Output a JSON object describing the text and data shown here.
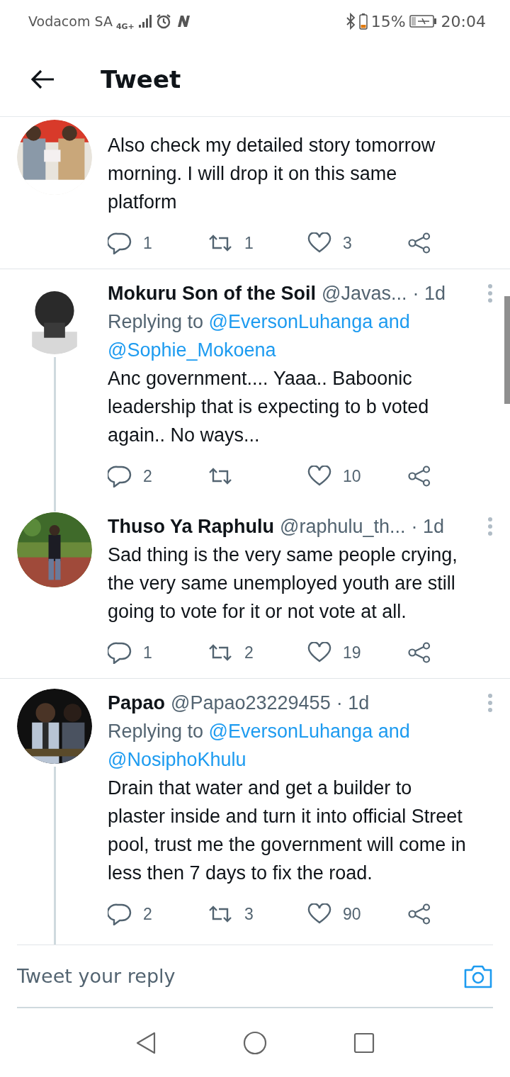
{
  "status_bar": {
    "carrier": "Vodacom SA",
    "network": "4G+",
    "battery_percent": "15%",
    "time": "20:04"
  },
  "header": {
    "title": "Tweet"
  },
  "tweets": [
    {
      "text": "Also check my detailed story tomorrow morning. I will drop it on this same platform",
      "replies": "1",
      "retweets": "1",
      "likes": "3",
      "thread_line": false,
      "divider_after": true
    },
    {
      "name": "Mokuru Son of the Soil",
      "handle": "@Javas...",
      "time": "· 1d",
      "replying_label": "Replying to",
      "replying_links": [
        "@EversonLuhanga and",
        "@Sophie_Mokoena"
      ],
      "text": "Anc government.... Yaaa.. Baboonic leadership that is expecting to b voted again.. No ways...",
      "replies": "2",
      "likes": "10",
      "thread_line": true,
      "divider_after": false
    },
    {
      "name": "Thuso Ya Raphulu",
      "handle": "@raphulu_th...",
      "time": "· 1d",
      "text": "Sad thing is the very same people crying, the very same unemployed youth are still going to vote for it or not vote at all.",
      "replies": "1",
      "retweets": "2",
      "likes": "19",
      "thread_line": false,
      "divider_after": true
    },
    {
      "name": "Papao",
      "handle": "@Papao23229455",
      "time": "· 1d",
      "replying_label": "Replying to",
      "replying_links": [
        "@EversonLuhanga and",
        "@NosiphoKhulu"
      ],
      "text": "Drain that water and get a builder to plaster inside and turn it into official Street pool, trust me the government will come in less then 7 days to fix the road.",
      "replies": "2",
      "retweets": "3",
      "likes": "90",
      "thread_line": true,
      "divider_after": false
    }
  ],
  "reply_box": {
    "placeholder": "Tweet your reply"
  }
}
